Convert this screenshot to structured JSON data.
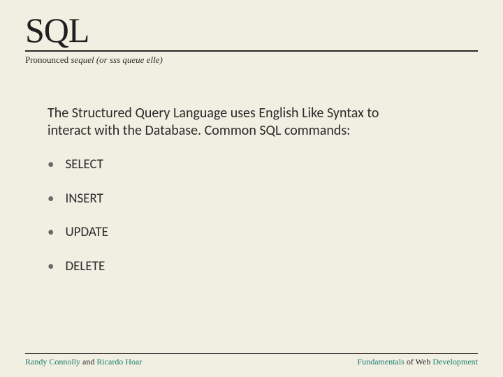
{
  "title": "SQL",
  "subtitle_parts": {
    "p1": "Pronounced ",
    "p2": "sequel",
    "p3": " (or ",
    "p4": "sss queue elle)"
  },
  "body": "The Structured Query Language uses English Like Syntax to interact with the Database. Common SQL commands:",
  "items": [
    {
      "label": "SELECT"
    },
    {
      "label": "INSERT"
    },
    {
      "label": "UPDATE"
    },
    {
      "label": "DELETE"
    }
  ],
  "footer": {
    "left": {
      "a1": "Randy Connolly",
      "mid": " and ",
      "a2": "Ricardo Hoar"
    },
    "right": {
      "w1": "Fundamentals",
      "mid": " of Web ",
      "w2": "Development"
    }
  }
}
